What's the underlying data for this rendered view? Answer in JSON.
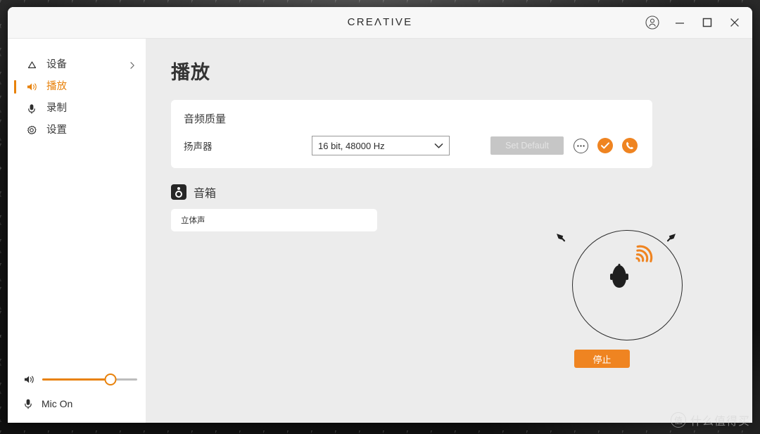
{
  "titlebar": {
    "brand": "CREΛTIVE",
    "brand_plain": "CREATIVE",
    "account_icon": "account-circle-icon",
    "minimize_icon": "minimize-icon",
    "maximize_icon": "maximize-icon",
    "close_icon": "close-icon"
  },
  "sidebar": {
    "items": [
      {
        "label": "设备",
        "icon": "device-triangle-icon",
        "active": false,
        "chevron": "›"
      },
      {
        "label": "播放",
        "icon": "speaker-wave-icon",
        "active": true
      },
      {
        "label": "录制",
        "icon": "microphone-icon",
        "active": false
      },
      {
        "label": "设置",
        "icon": "gear-icon",
        "active": false
      }
    ],
    "volume": {
      "icon": "volume-icon",
      "value": 72
    },
    "mic": {
      "icon": "microphone-icon",
      "label": "Mic On"
    }
  },
  "content": {
    "page_title": "播放",
    "quality_card": {
      "title": "音频质量",
      "device_label": "扬声器",
      "format_value": "16 bit, 48000 Hz",
      "format_chevron_icon": "chevron-down-icon",
      "set_default_label": "Set Default",
      "more_icon": "ellipsis-icon",
      "default_device_badge_icon": "check-circle-icon",
      "default_comm_badge_icon": "phone-circle-icon"
    },
    "speaker_section": {
      "icon": "speaker-box-icon",
      "title": "音箱",
      "mode_value": "立体声"
    },
    "diagram": {
      "left_speaker_icon": "speaker-cone-icon",
      "right_speaker_icon": "speaker-cone-icon",
      "listener_icon": "head-top-view-icon",
      "active_waves_icon": "sound-waves-icon",
      "active_channel": "right",
      "stop_button_label": "停止"
    }
  },
  "watermark": {
    "mark": "值",
    "text": "什么值得买"
  },
  "colors": {
    "accent": "#ef8421",
    "accent_text": "#e8820c",
    "content_bg": "#ececec",
    "card_bg": "#ffffff",
    "disabled_btn": "#c6c6c6"
  }
}
